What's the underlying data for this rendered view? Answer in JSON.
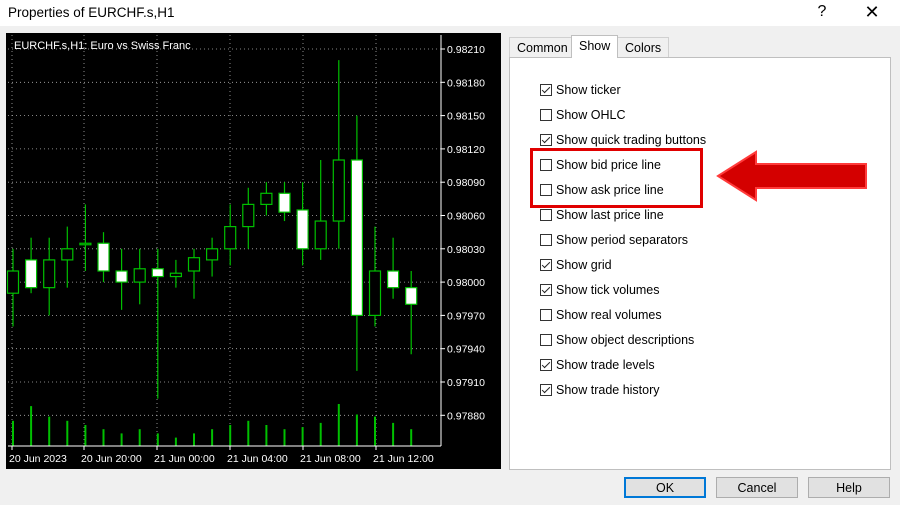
{
  "window": {
    "title": "Properties of EURCHF.s,H1",
    "help_glyph": "?",
    "close_glyph": "✕"
  },
  "tabs": [
    {
      "label": "Common",
      "active": false
    },
    {
      "label": "Show",
      "active": true
    },
    {
      "label": "Colors",
      "active": false
    }
  ],
  "options": [
    {
      "label": "Show ticker",
      "checked": true
    },
    {
      "label": "Show OHLC",
      "checked": false
    },
    {
      "label": "Show quick trading buttons",
      "checked": true
    },
    {
      "label": "Show bid price line",
      "checked": false
    },
    {
      "label": "Show ask price line",
      "checked": false
    },
    {
      "label": "Show last price line",
      "checked": false
    },
    {
      "label": "Show period separators",
      "checked": false
    },
    {
      "label": "Show grid",
      "checked": true
    },
    {
      "label": "Show tick volumes",
      "checked": true
    },
    {
      "label": "Show real volumes",
      "checked": false
    },
    {
      "label": "Show object descriptions",
      "checked": false
    },
    {
      "label": "Show trade levels",
      "checked": true
    },
    {
      "label": "Show trade history",
      "checked": true
    }
  ],
  "buttons": {
    "ok": "OK",
    "cancel": "Cancel",
    "help": "Help"
  },
  "annotation": {
    "highlight_color": "#e00000",
    "arrow_color": "#d40000"
  },
  "chart": {
    "label": "EURCHF.s,H1:  Euro vs Swiss Franc",
    "price_labels": [
      "0.98210",
      "0.98180",
      "0.98150",
      "0.98120",
      "0.98090",
      "0.98060",
      "0.98030",
      "0.98000",
      "0.97970",
      "0.97940",
      "0.97910",
      "0.97880"
    ],
    "time_labels": [
      "20 Jun 2023",
      "20 Jun 20:00",
      "21 Jun 00:00",
      "21 Jun 04:00",
      "21 Jun 08:00",
      "21 Jun 12:00"
    ],
    "bull_color": "#00c000",
    "bear_fill": "#ffffff",
    "grid_color": "#b0b0b0"
  },
  "chart_data": {
    "type": "candlestick",
    "ylim": [
      0.97865,
      0.9822
    ],
    "grid": true,
    "candles": [
      {
        "o": 0.9799,
        "h": 0.9803,
        "l": 0.9796,
        "c": 0.9801,
        "v": 0.6
      },
      {
        "o": 0.9802,
        "h": 0.9804,
        "l": 0.9799,
        "c": 0.97995,
        "v": 0.95
      },
      {
        "o": 0.97995,
        "h": 0.9804,
        "l": 0.9797,
        "c": 0.9802,
        "v": 0.7
      },
      {
        "o": 0.9802,
        "h": 0.9805,
        "l": 0.97995,
        "c": 0.9803,
        "v": 0.6
      },
      {
        "o": 0.98035,
        "h": 0.9807,
        "l": 0.9801,
        "c": 0.98035,
        "v": 0.5
      },
      {
        "o": 0.98035,
        "h": 0.98045,
        "l": 0.98,
        "c": 0.9801,
        "v": 0.4
      },
      {
        "o": 0.9801,
        "h": 0.9803,
        "l": 0.97975,
        "c": 0.98,
        "v": 0.3
      },
      {
        "o": 0.98,
        "h": 0.9803,
        "l": 0.9798,
        "c": 0.98012,
        "v": 0.4
      },
      {
        "o": 0.98012,
        "h": 0.9803,
        "l": 0.97895,
        "c": 0.98005,
        "v": 0.3
      },
      {
        "o": 0.98005,
        "h": 0.9802,
        "l": 0.97995,
        "c": 0.98008,
        "v": 0.2
      },
      {
        "o": 0.9801,
        "h": 0.9803,
        "l": 0.97985,
        "c": 0.98022,
        "v": 0.3
      },
      {
        "o": 0.9802,
        "h": 0.9804,
        "l": 0.98005,
        "c": 0.9803,
        "v": 0.4
      },
      {
        "o": 0.9803,
        "h": 0.9807,
        "l": 0.98015,
        "c": 0.9805,
        "v": 0.5
      },
      {
        "o": 0.9805,
        "h": 0.98085,
        "l": 0.9803,
        "c": 0.9807,
        "v": 0.6
      },
      {
        "o": 0.9807,
        "h": 0.9809,
        "l": 0.9806,
        "c": 0.9808,
        "v": 0.5
      },
      {
        "o": 0.9808,
        "h": 0.9809,
        "l": 0.98055,
        "c": 0.98063,
        "v": 0.4
      },
      {
        "o": 0.98065,
        "h": 0.9809,
        "l": 0.98015,
        "c": 0.9803,
        "v": 0.45
      },
      {
        "o": 0.9803,
        "h": 0.9811,
        "l": 0.9802,
        "c": 0.98055,
        "v": 0.55
      },
      {
        "o": 0.98055,
        "h": 0.982,
        "l": 0.9803,
        "c": 0.9811,
        "v": 1.0
      },
      {
        "o": 0.9811,
        "h": 0.9815,
        "l": 0.9792,
        "c": 0.9797,
        "v": 0.75
      },
      {
        "o": 0.9797,
        "h": 0.9805,
        "l": 0.9796,
        "c": 0.9801,
        "v": 0.7
      },
      {
        "o": 0.9801,
        "h": 0.9804,
        "l": 0.97985,
        "c": 0.97995,
        "v": 0.55
      },
      {
        "o": 0.97995,
        "h": 0.9801,
        "l": 0.97935,
        "c": 0.9798,
        "v": 0.4
      }
    ]
  }
}
